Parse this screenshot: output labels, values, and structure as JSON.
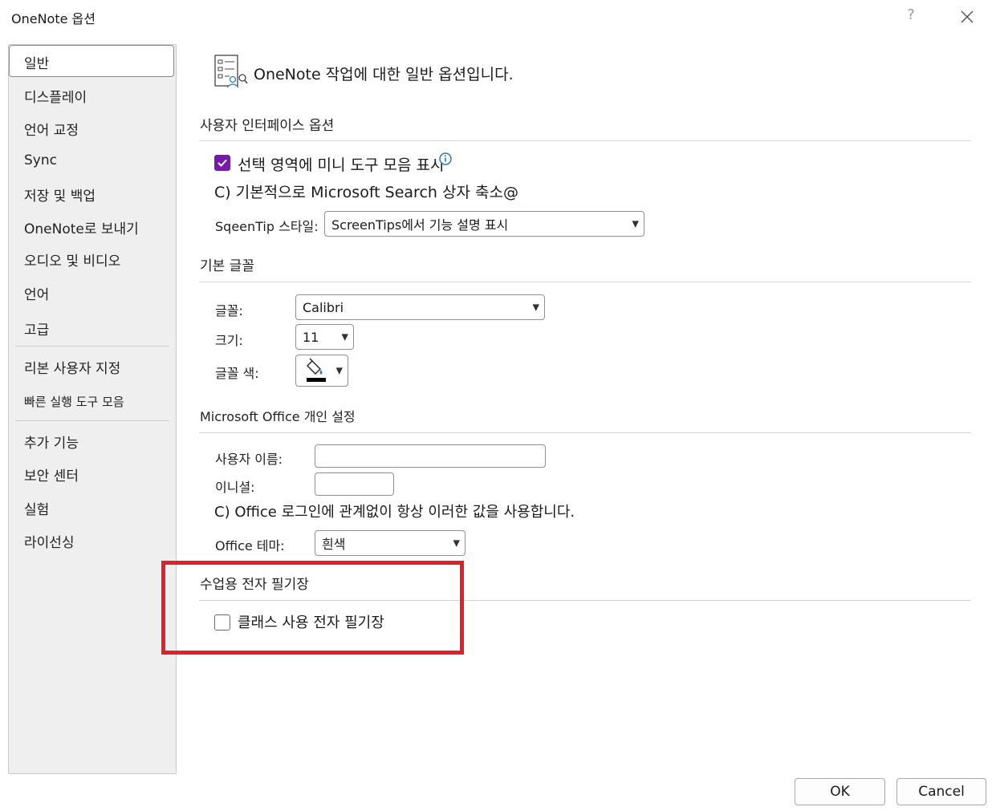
{
  "window": {
    "title": "OneNote 옵션",
    "help_label": "?"
  },
  "sidebar": {
    "items": [
      {
        "label": "일반",
        "selected": true
      },
      {
        "label": "디스플레이"
      },
      {
        "label": "언어 교정"
      },
      {
        "label": "Sync"
      },
      {
        "label": "저장 및 백업"
      },
      {
        "label": "OneNote로 보내기"
      },
      {
        "label": "오디오 및 비디오"
      },
      {
        "label": "언어"
      },
      {
        "label": "고급"
      },
      {
        "label": "리본 사용자 지정"
      },
      {
        "label": "빠른 실행 도구 모음"
      },
      {
        "label": "추가 기능"
      },
      {
        "label": "보안 센터"
      },
      {
        "label": "실험"
      },
      {
        "label": "라이선싱"
      }
    ]
  },
  "main": {
    "header": "OneNote 작업에 대한 일반 옵션입니다.",
    "ui_options": {
      "title": "사용자 인터페이스 옵션",
      "mini_toolbar_label": "선택 영역에 미니 도구 모음 표시",
      "mini_toolbar_checked": true,
      "collapse_search_label": "C) 기본적으로 Microsoft Search 상자 축소@",
      "screentip_label": "SqeenTip 스타일:",
      "screentip_value": "ScreenTips에서 기능 설명 표시"
    },
    "default_font": {
      "title": "기본 글꼴",
      "font_label": "글꼴:",
      "font_value": "Calibri",
      "size_label": "크기:",
      "size_value": "11",
      "color_label": "글꼴 색:"
    },
    "personalize": {
      "title": "Microsoft  Office 개인 설정",
      "username_label": "사용자 이름:",
      "username_value": "",
      "initials_label": "이니셜:",
      "initials_value": "",
      "always_use_label": "C) Office 로그인에 관계없이 항상 이러한 값을 사용합니다.",
      "theme_label": "Office 테마:",
      "theme_value": "흰색"
    },
    "class_notebook": {
      "title": "수업용 전자 필기장",
      "class_notebook_label": "클래스 사용  전자 필기장",
      "class_notebook_checked": false
    }
  },
  "footer": {
    "ok_label": "OK",
    "cancel_label": "Cancel"
  },
  "colors": {
    "accent": "#7719aa",
    "highlight": "#e0202a"
  }
}
